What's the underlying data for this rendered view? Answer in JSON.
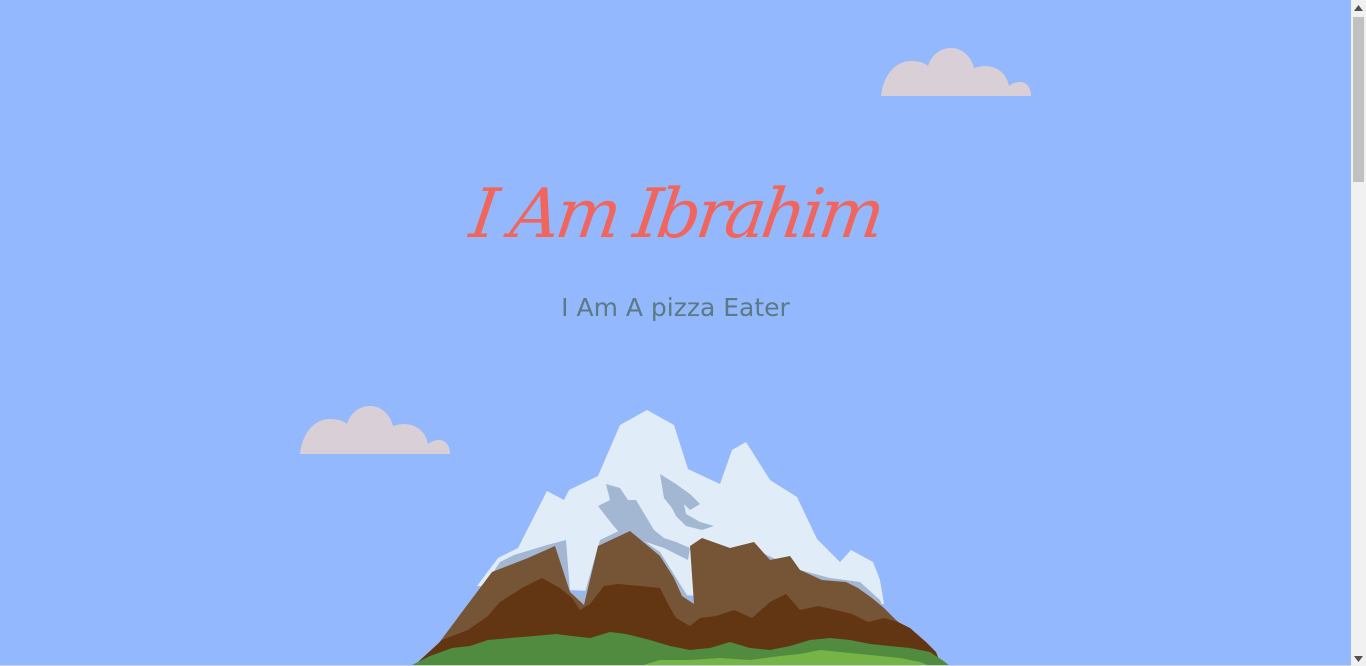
{
  "hero": {
    "title": "I Am Ibrahim",
    "subtitle": "I Am A pizza Eater"
  },
  "colors": {
    "sky": "#94b8fd",
    "title": "#f0665f",
    "subtitle": "#5a7a85",
    "cloud": "#d9cfd7",
    "snow_light": "#e0edf8",
    "snow_shadow": "#a3b7d2",
    "rock_light": "#765436",
    "rock_dark": "#623613",
    "grass_dark": "#518b3f",
    "grass_light": "#76b447",
    "scrollbar_track": "#f1f1f1",
    "scrollbar_thumb": "#c1c1c1"
  },
  "icons": {
    "scroll_up": "triangle-up",
    "scroll_down": "triangle-down"
  }
}
